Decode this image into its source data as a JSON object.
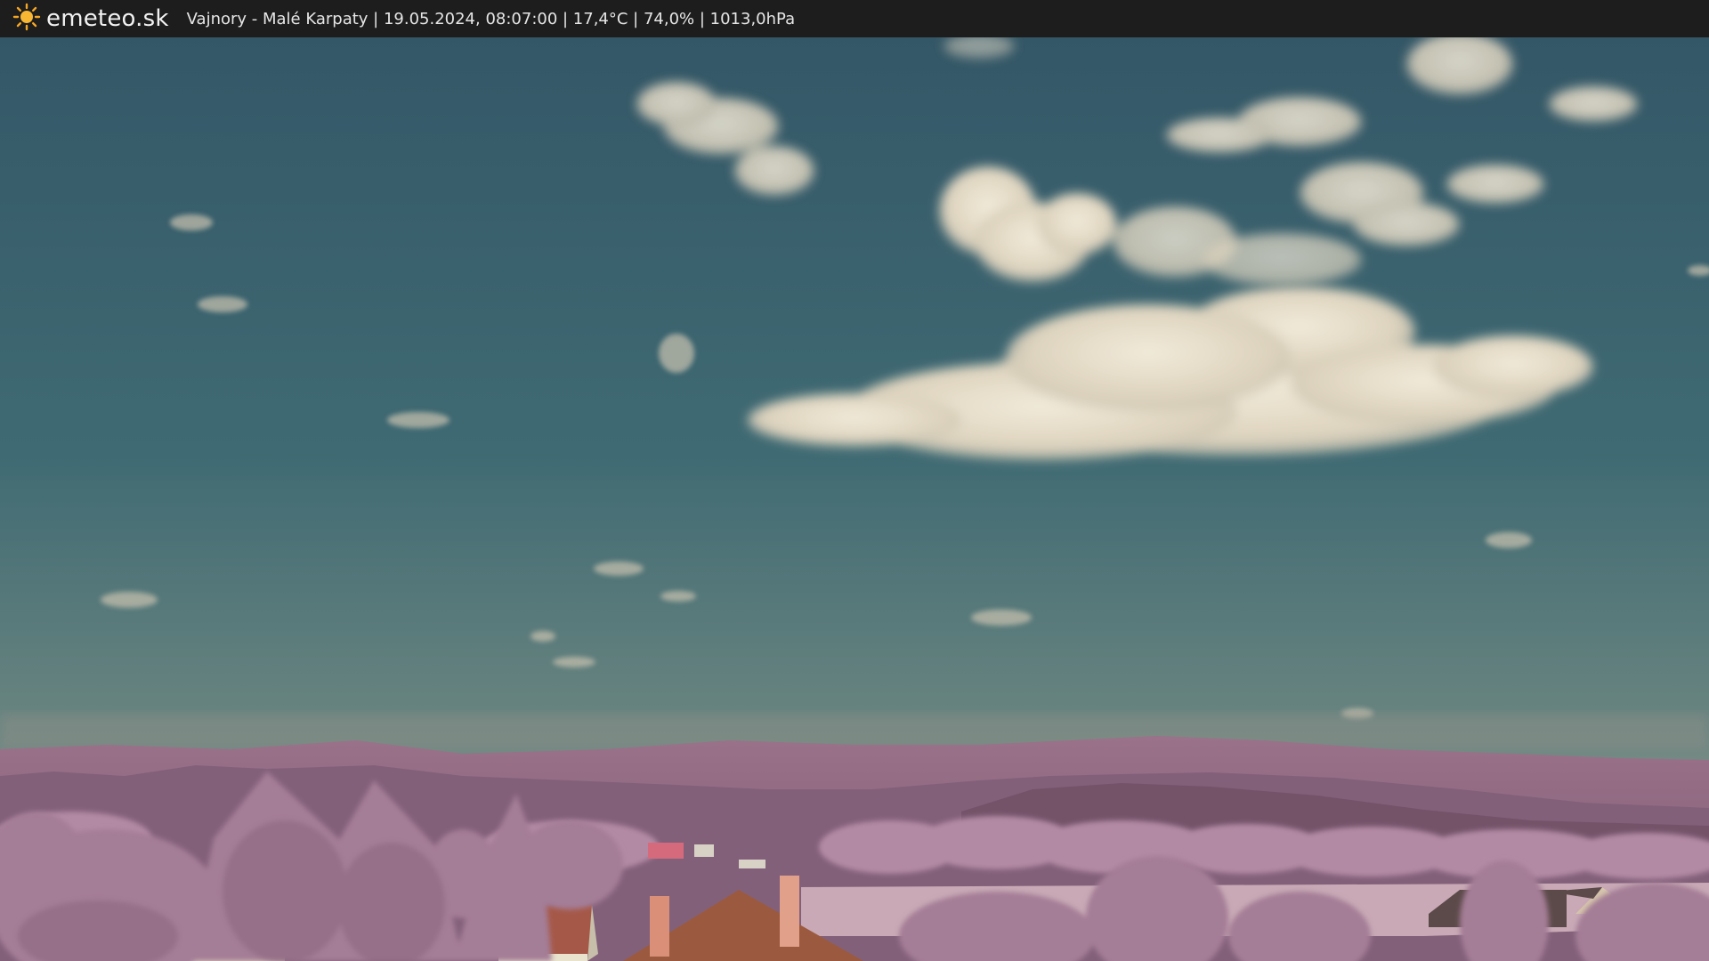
{
  "header": {
    "brand": "emeteo.sk",
    "brand_icon": "sun-icon",
    "caption": "Vajnory - Malé Karpaty | 19.05.2024, 08:07:00 | 17,4°C | 74,0% | 1013,0hPa"
  },
  "colors": {
    "bar_background": "#1d1d1d",
    "sun": "#f5a623",
    "sky_top": "#3a5e6e",
    "sky_bottom": "#7a8a85",
    "foliage": "#a97f99",
    "roof": "#9b5a3f"
  }
}
